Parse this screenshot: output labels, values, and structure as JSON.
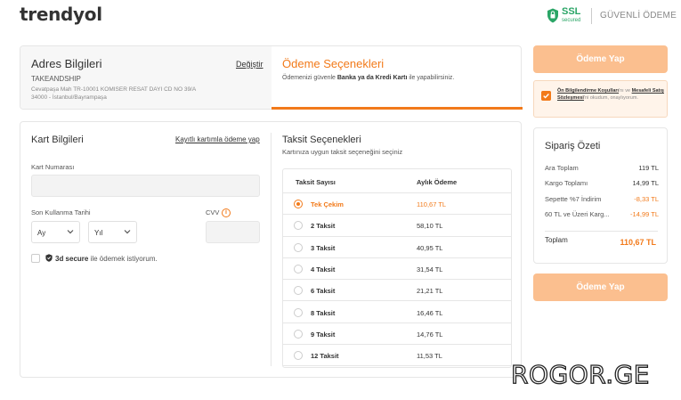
{
  "header": {
    "logo": "trendyol",
    "ssl_big": "SSL",
    "ssl_small": "secured",
    "secure_label": "GÜVENLİ ÖDEME"
  },
  "address": {
    "title": "Adres Bilgileri",
    "change_label": "Değiştir",
    "name": "TAKEANDSHIP",
    "line1": "Cevatpaşa Mah TR-10001 KOMISER RESAT DAYI CD NO 39/A",
    "line2": "34000 - İstanbul/Bayrampaşa"
  },
  "payment": {
    "title": "Ödeme Seçenekleri",
    "desc_prefix": "Ödemenizi güvenle ",
    "desc_bold": "Banka ya da Kredi Kartı",
    "desc_suffix": " ile yapabilirsiniz."
  },
  "card_info": {
    "title": "Kart Bilgileri",
    "save_link": "Kayıtlı kartımla ödeme yap",
    "number_label": "Kart Numarası",
    "expiry_label": "Son Kullanma Tarihi",
    "month_select": "Ay",
    "year_select": "Yıl",
    "cvv_label": "CVV",
    "info_glyph": "i",
    "secure_bold": "3d secure",
    "secure_text": " ile ödemek istiyorum."
  },
  "installments": {
    "title": "Taksit Seçenekleri",
    "desc": "Kartınıza uygun taksit seçeneğini seçiniz",
    "col_count": "Taksit Sayısı",
    "col_amount": "Aylık Ödeme",
    "rows": [
      {
        "count": "Tek Çekim",
        "amount": "110,67 TL",
        "selected": true
      },
      {
        "count": "2 Taksit",
        "amount": "58,10 TL",
        "selected": false
      },
      {
        "count": "3 Taksit",
        "amount": "40,95 TL",
        "selected": false
      },
      {
        "count": "4 Taksit",
        "amount": "31,54 TL",
        "selected": false
      },
      {
        "count": "6 Taksit",
        "amount": "21,21 TL",
        "selected": false
      },
      {
        "count": "8 Taksit",
        "amount": "16,46 TL",
        "selected": false
      },
      {
        "count": "9 Taksit",
        "amount": "14,76 TL",
        "selected": false
      },
      {
        "count": "12 Taksit",
        "amount": "11,53 TL",
        "selected": false
      }
    ]
  },
  "actions": {
    "pay_button": "Ödeme Yap"
  },
  "agreement": {
    "link1": "Ön Bilgilendirme Koşulları",
    "mid": "'nı ve ",
    "link2": "Mesafeli Satış Sözleşmesi",
    "end": "'ni okudum, onaylıyorum.",
    "checked": true
  },
  "summary": {
    "title": "Sipariş Özeti",
    "rows": [
      {
        "label": "Ara Toplam",
        "value": "119 TL",
        "discount": false
      },
      {
        "label": "Kargo Toplamı",
        "value": "14,99 TL",
        "discount": false
      },
      {
        "label": "Sepette %7 İndirim",
        "value": "-8,33 TL",
        "discount": true
      },
      {
        "label": "60 TL ve Üzeri Karg...",
        "value": "-14,99 TL",
        "discount": true
      }
    ],
    "total_label": "Toplam",
    "total_value": "110,67 TL"
  },
  "watermark": "ROGOR.GE",
  "colors": {
    "accent": "#f27a1a",
    "button_disabled": "#fbbf8f",
    "ssl_green": "#2aa566"
  }
}
